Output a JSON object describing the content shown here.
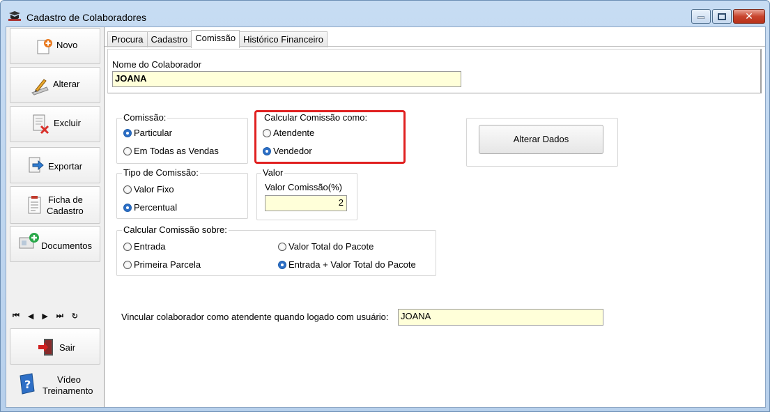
{
  "window": {
    "title": "Cadastro de Colaboradores",
    "close_glyph": "✕"
  },
  "sidebar": {
    "novo": "Novo",
    "alterar": "Alterar",
    "excluir": "Excluir",
    "exportar": "Exportar",
    "ficha_line1": "Ficha de",
    "ficha_line2": "Cadastro",
    "documentos": "Documentos",
    "nav": [
      "⏮",
      "◀",
      "▶",
      "⏭",
      "↻"
    ],
    "sair": "Sair",
    "video_line1": "Vídeo",
    "video_line2": "Treinamento"
  },
  "tabs": [
    "Procura",
    "Cadastro",
    "Comissão",
    "Histórico Financeiro"
  ],
  "active_tab": "Comissão",
  "nome": {
    "label": "Nome do Colaborador",
    "value": "JOANA"
  },
  "comissao": {
    "title": "Comissão:",
    "options": [
      "Particular",
      "Em Todas as Vendas"
    ],
    "selected": "Particular"
  },
  "calcular_como": {
    "title": "Calcular Comissão como:",
    "options": [
      "Atendente",
      "Vendedor"
    ],
    "selected": "Vendedor"
  },
  "alterar_dados": "Alterar Dados",
  "tipo": {
    "title": "Tipo de Comissão:",
    "options": [
      "Valor Fixo",
      "Percentual"
    ],
    "selected": "Percentual"
  },
  "valor": {
    "title": "Valor",
    "label": "Valor Comissão(%)",
    "value": "2"
  },
  "calcular_sobre": {
    "title": "Calcular Comissão sobre:",
    "options": [
      "Entrada",
      "Primeira Parcela",
      "Valor Total do Pacote",
      "Entrada + Valor Total do Pacote"
    ],
    "selected": "Entrada + Valor Total do Pacote"
  },
  "vincular": {
    "label": "Vincular colaborador como atendente quando logado com usuário:",
    "value": "JOANA"
  },
  "colors": {
    "highlight": "#e02020",
    "input_bg": "#ffffd9",
    "radio_selected": "#2d6fc6"
  }
}
